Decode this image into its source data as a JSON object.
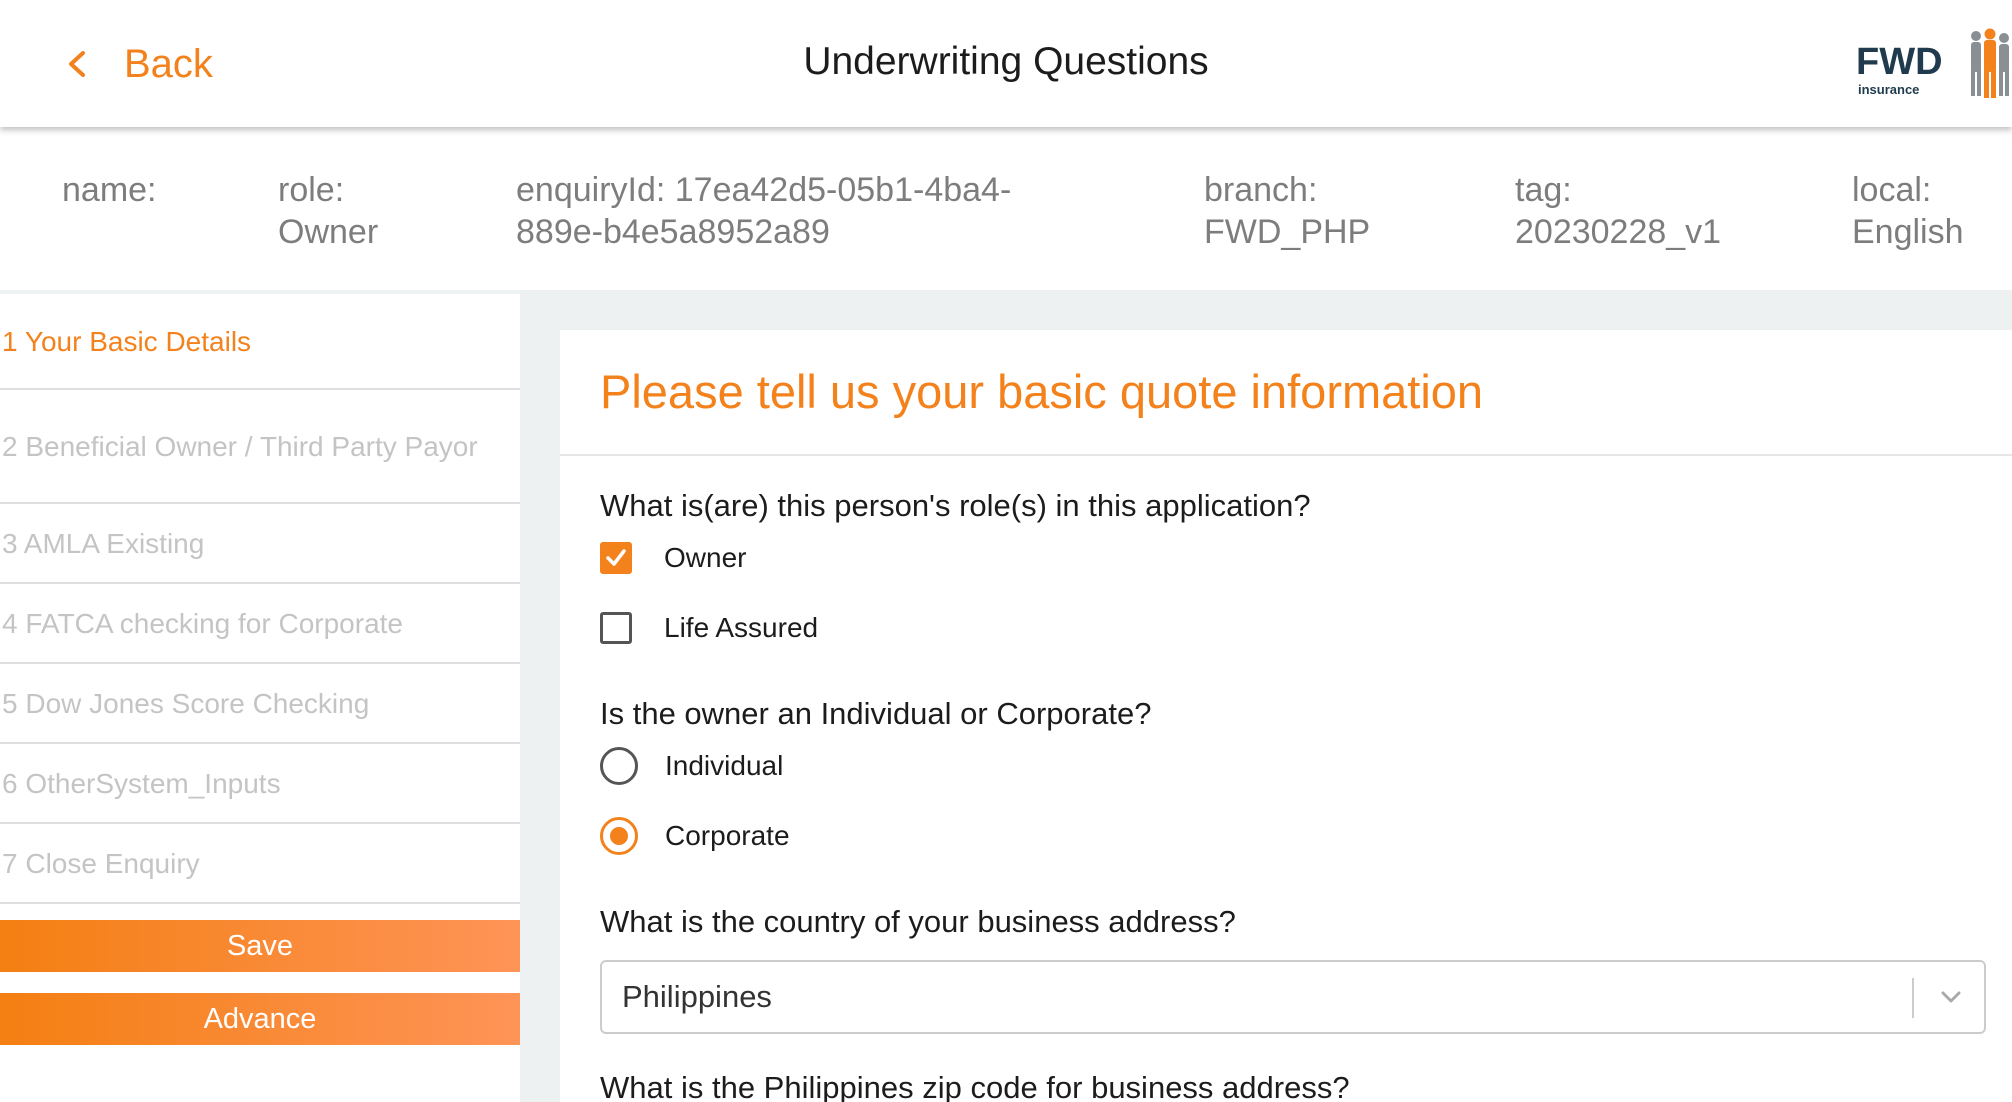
{
  "header": {
    "back_label": "Back",
    "title": "Underwriting Questions",
    "logo_text": "FWD",
    "logo_sub": "insurance"
  },
  "info": {
    "name": "name:",
    "role": "role:\nOwner",
    "enquiry": "enquiryId: 17ea42d5-05b1-4ba4-\n889e-b4e5a8952a89",
    "branch": "branch:\nFWD_PHP",
    "tag": "tag:\n20230228_v1",
    "local": "local:\nEnglish"
  },
  "sidebar": {
    "steps": [
      {
        "label": "1 Your Basic Details",
        "active": true
      },
      {
        "label": "2 Beneficial Owner / Third Party Payor",
        "active": false
      },
      {
        "label": "3 AMLA Existing",
        "active": false
      },
      {
        "label": "4 FATCA checking for Corporate",
        "active": false
      },
      {
        "label": "5 Dow Jones Score Checking",
        "active": false
      },
      {
        "label": "6 OtherSystem_Inputs",
        "active": false
      },
      {
        "label": "7 Close Enquiry",
        "active": false
      }
    ],
    "save_label": "Save",
    "advance_label": "Advance"
  },
  "form": {
    "title": "Please tell us your basic quote information",
    "q_roles": "What is(are) this person's role(s) in this application?",
    "roles": [
      {
        "label": "Owner",
        "checked": true
      },
      {
        "label": "Life Assured",
        "checked": false
      }
    ],
    "q_owner_type": "Is the owner an Individual or Corporate?",
    "owner_types": [
      {
        "label": "Individual",
        "selected": false
      },
      {
        "label": "Corporate",
        "selected": true
      }
    ],
    "q_country": "What is the country of your business address?",
    "country_value": "Philippines",
    "q_zip": "What is the Philippines zip code for business address?"
  },
  "colors": {
    "accent": "#f3821c",
    "button_gradient_end": "#fe9457",
    "muted_text": "#7d7d7d",
    "disabled_text": "#c4c4c4"
  }
}
